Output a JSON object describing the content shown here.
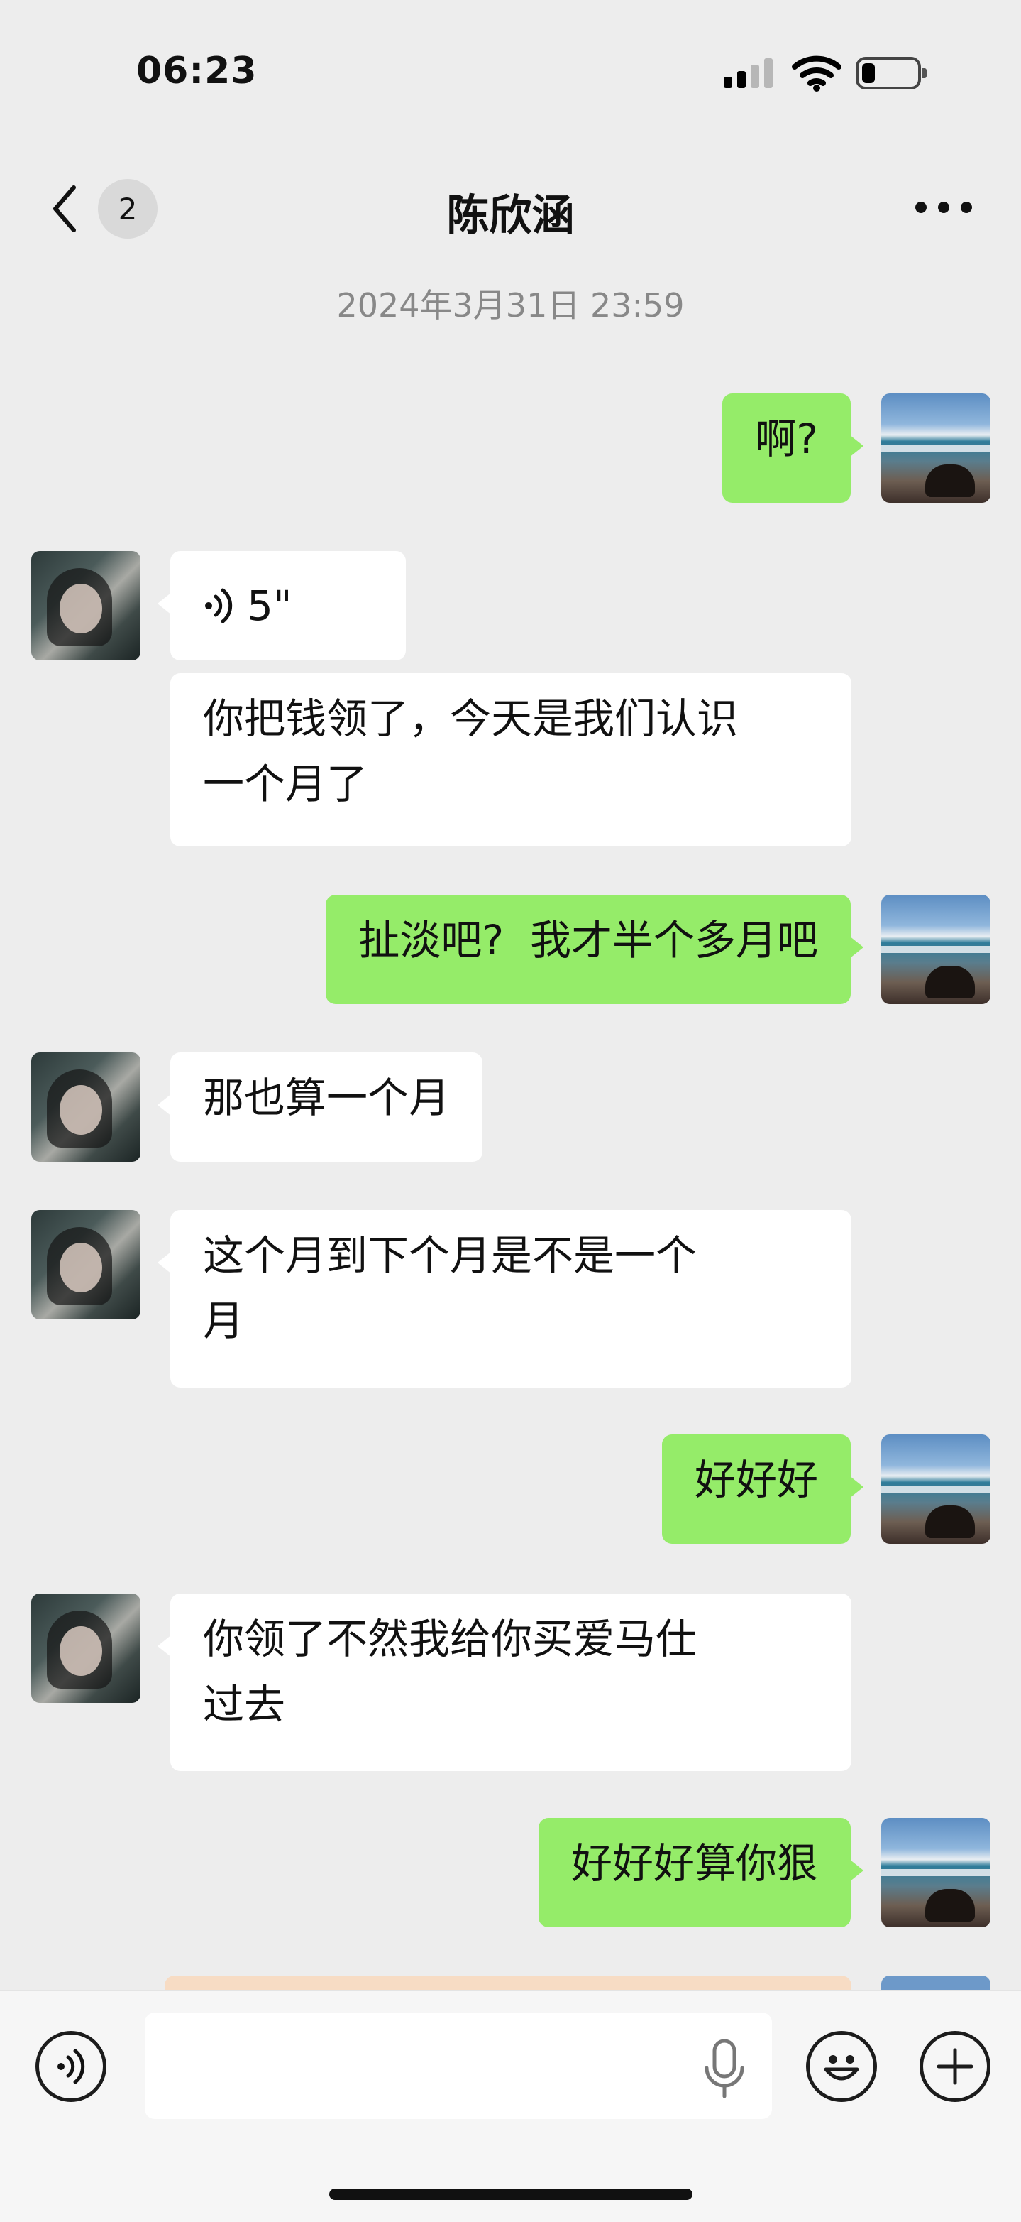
{
  "status_bar": {
    "time": "06:23"
  },
  "nav": {
    "unread_count": "2",
    "title": "陈欣涵"
  },
  "timestamp": "2024年3月31日 23:59",
  "messages": [
    {
      "from": "me",
      "text": "啊?"
    },
    {
      "from": "her",
      "type": "voice",
      "duration": "5\""
    },
    {
      "from": "her",
      "text": "你把钱领了，今天是我们认识\n一个月了"
    },
    {
      "from": "me",
      "text": "扯淡吧?  我才半个多月吧"
    },
    {
      "from": "her",
      "text": "那也算一个月"
    },
    {
      "from": "her",
      "text": "这个月到下个月是不是一个\n月"
    },
    {
      "from": "me",
      "text": "好好好"
    },
    {
      "from": "her",
      "text": "你领了不然我给你买爱马仕\n过去"
    },
    {
      "from": "me",
      "text": "好好好算你狠"
    }
  ],
  "colors": {
    "my_bubble": "#95ec69",
    "her_bubble": "#ffffff",
    "background": "#ededed"
  }
}
